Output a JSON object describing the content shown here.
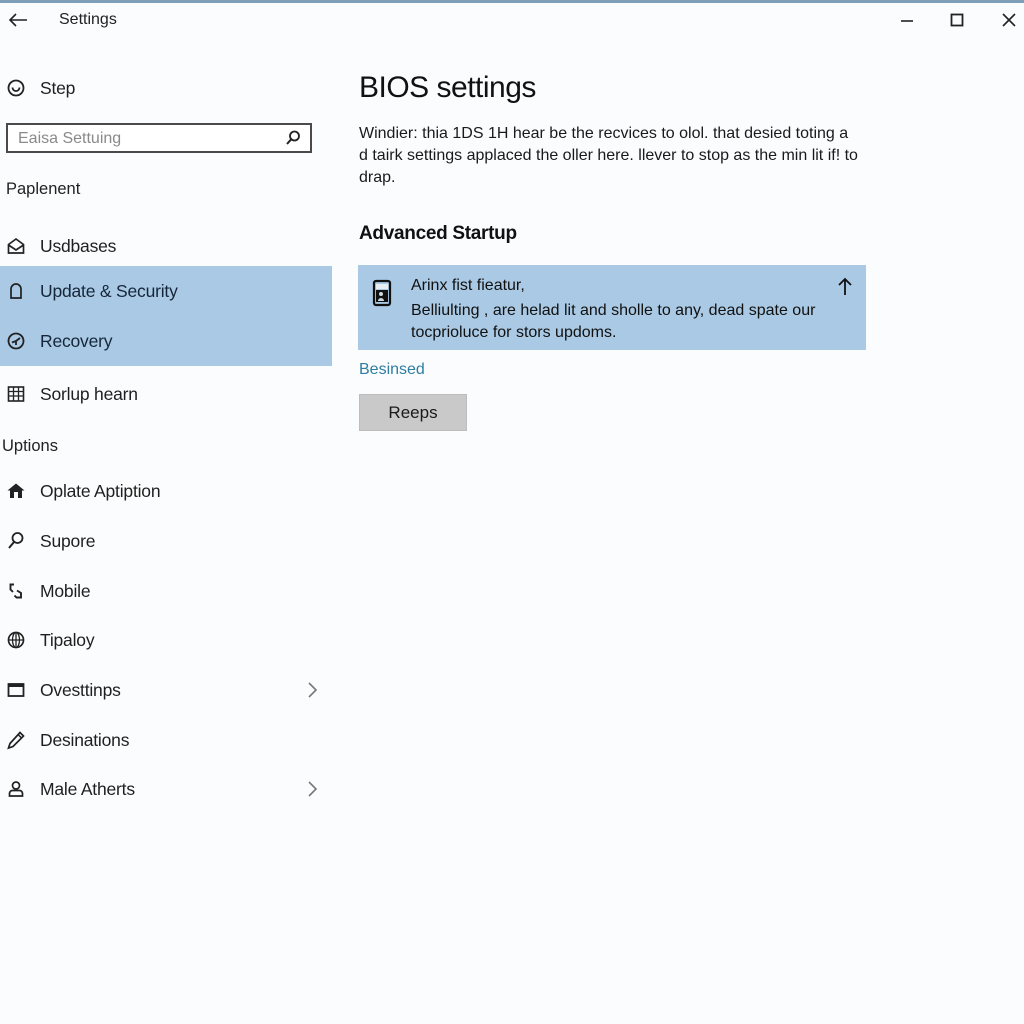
{
  "window": {
    "title": "Settings",
    "controls": {
      "minimize": "minimize",
      "maximize": "maximize",
      "close": "close"
    }
  },
  "sidebar": {
    "home_label": "Step",
    "search": {
      "placeholder": "Eaisa Settuing",
      "value": ""
    },
    "section_1_header": "Paplenent",
    "section_1_items": [
      {
        "label": "Usdbases",
        "icon": "mail-open-icon",
        "selected": false
      },
      {
        "label": "Update & Security",
        "icon": "bell-icon",
        "selected": true
      },
      {
        "label": "Recovery",
        "icon": "recovery-clock-icon",
        "selected": true
      },
      {
        "label": "Sorlup hearn",
        "icon": "grid-icon",
        "selected": false
      }
    ],
    "section_2_header": "Uptions",
    "section_2_items": [
      {
        "label": "Oplate Aptiption",
        "icon": "home-icon",
        "chevron": false
      },
      {
        "label": "Supore",
        "icon": "search-icon",
        "chevron": false
      },
      {
        "label": "Mobile",
        "icon": "link-icon",
        "chevron": false
      },
      {
        "label": "Tipaloy",
        "icon": "globe-icon",
        "chevron": false
      },
      {
        "label": "Ovesttinps",
        "icon": "window-icon",
        "chevron": true
      },
      {
        "label": "Desinations",
        "icon": "pen-icon",
        "chevron": false
      },
      {
        "label": "Male Atherts",
        "icon": "person-icon",
        "chevron": true
      }
    ]
  },
  "main": {
    "title": "BIOS settings",
    "description": "Windier: thia 1DS 1H hear be the recvices to olol. that desied toting a d tairk settings applaced the oller here. llever to stop as the min lit if! to drap.",
    "section_title": "Advanced Startup",
    "banner": {
      "title": "Arinx fist fieatur,",
      "body": "Belliulting , are helad lit and sholle to any, dead spate our tocprioluce for stors updoms.",
      "icon": "device-icon",
      "action_icon": "arrow-up-icon"
    },
    "link_label": "Besinsed",
    "button_label": "Reeps"
  },
  "colors": {
    "selected_bg": "#a9c9e4",
    "link": "#2e7ea0",
    "button_bg": "#c9c9c9"
  }
}
